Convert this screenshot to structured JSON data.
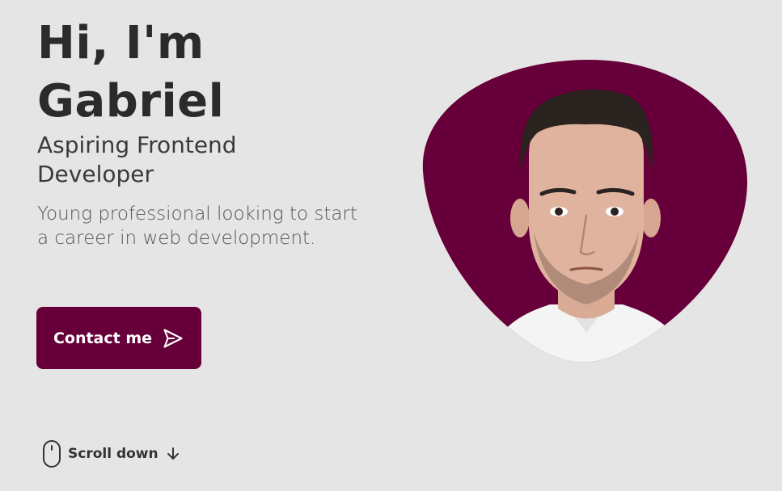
{
  "hero": {
    "title_line1": "Hi, I'm",
    "title_line2": "Gabriel",
    "subtitle": "Aspiring Frontend Developer",
    "description": "Young professional looking to start a career in web development.",
    "contact_label": "Contact me",
    "scroll_label": "Scroll down"
  },
  "icons": {
    "contact": "send-icon",
    "scroll": "mouse-icon",
    "arrow": "arrow-down-icon"
  },
  "colors": {
    "background": "#e6e5e5",
    "accent": "#67003a",
    "text": "#2b2b2b"
  }
}
